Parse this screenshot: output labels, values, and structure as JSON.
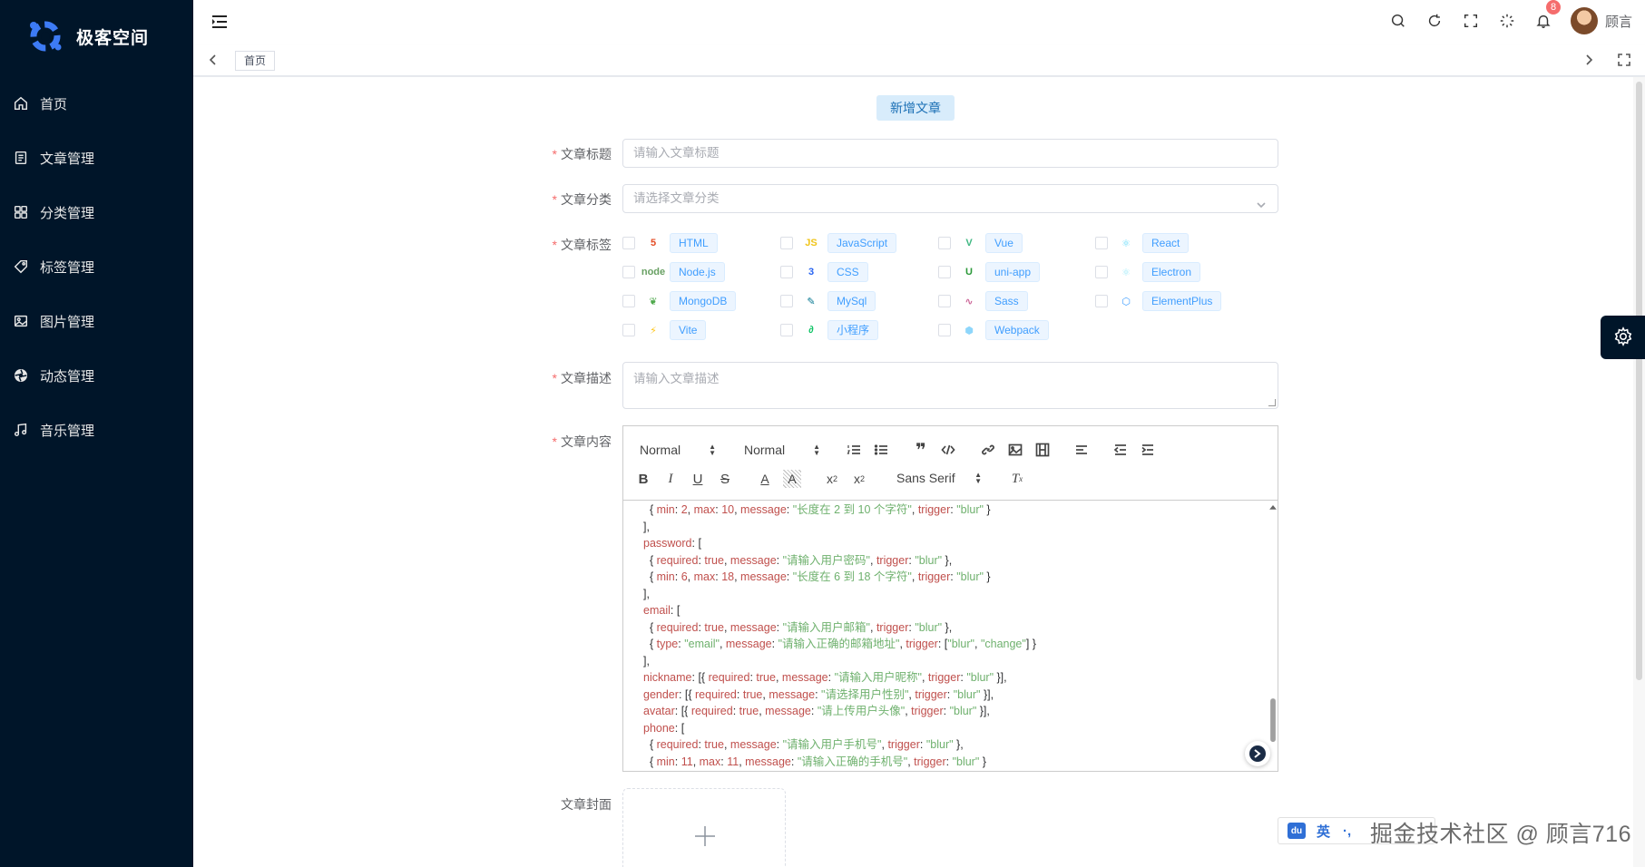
{
  "app": {
    "name": "极客空间"
  },
  "menu": [
    {
      "label": "首页",
      "icon": "home-icon"
    },
    {
      "label": "文章管理",
      "icon": "document-icon"
    },
    {
      "label": "分类管理",
      "icon": "grid-icon"
    },
    {
      "label": "标签管理",
      "icon": "tag-icon"
    },
    {
      "label": "图片管理",
      "icon": "image-icon"
    },
    {
      "label": "动态管理",
      "icon": "aperture-icon"
    },
    {
      "label": "音乐管理",
      "icon": "music-icon"
    }
  ],
  "header": {
    "notification_count": "8",
    "username": "顾言"
  },
  "tabs": {
    "home": "首页"
  },
  "page": {
    "title": "新增文章"
  },
  "form": {
    "title_label": "文章标题",
    "title_placeholder": "请输入文章标题",
    "category_label": "文章分类",
    "category_placeholder": "请选择文章分类",
    "tags_label": "文章标签",
    "desc_label": "文章描述",
    "desc_placeholder": "请输入文章描述",
    "content_label": "文章内容",
    "cover_label": "文章封面",
    "required_mark": "*"
  },
  "tags": [
    {
      "name": "HTML",
      "logo": "html5-icon",
      "color": "#e44d26",
      "glyph": "5"
    },
    {
      "name": "JavaScript",
      "logo": "js-icon",
      "color": "#f0c419",
      "glyph": "JS"
    },
    {
      "name": "Vue",
      "logo": "vue-icon",
      "color": "#41b883",
      "glyph": "V"
    },
    {
      "name": "React",
      "logo": "react-icon",
      "color": "#61dafb",
      "glyph": "⚛"
    },
    {
      "name": "Node.js",
      "logo": "nodejs-icon",
      "color": "#68a063",
      "glyph": "node"
    },
    {
      "name": "CSS",
      "logo": "css3-icon",
      "color": "#2965f1",
      "glyph": "3"
    },
    {
      "name": "uni-app",
      "logo": "uniapp-icon",
      "color": "#2b9939",
      "glyph": "U"
    },
    {
      "name": "Electron",
      "logo": "electron-icon",
      "color": "#9feaf9",
      "glyph": "⚛"
    },
    {
      "name": "MongoDB",
      "logo": "mongodb-icon",
      "color": "#4fa94d",
      "glyph": "❦"
    },
    {
      "name": "MySql",
      "logo": "mysql-icon",
      "color": "#00758f",
      "glyph": "✎"
    },
    {
      "name": "Sass",
      "logo": "sass-icon",
      "color": "#cd6799",
      "glyph": "∿"
    },
    {
      "name": "ElementPlus",
      "logo": "elementplus-icon",
      "color": "#409eff",
      "glyph": "⬡"
    },
    {
      "name": "Vite",
      "logo": "vite-icon",
      "color": "#ffc517",
      "glyph": "⚡"
    },
    {
      "name": "小程序",
      "logo": "miniprogram-icon",
      "color": "#07c160",
      "glyph": "∂"
    },
    {
      "name": "Webpack",
      "logo": "webpack-icon",
      "color": "#8ed6fb",
      "glyph": "⬢"
    }
  ],
  "editor": {
    "header_select": "Normal",
    "size_select": "Normal",
    "font_select": "Sans Serif",
    "code_lines": [
      [
        [
          "p",
          "  { "
        ],
        [
          "k",
          "min"
        ],
        [
          "p",
          ": "
        ],
        [
          "n",
          "2"
        ],
        [
          "p",
          ", "
        ],
        [
          "k",
          "max"
        ],
        [
          "p",
          ": "
        ],
        [
          "n",
          "10"
        ],
        [
          "p",
          ", "
        ],
        [
          "k",
          "message"
        ],
        [
          "p",
          ": "
        ],
        [
          "s",
          "\"长度在 2 到 10 个字符\""
        ],
        [
          "p",
          ", "
        ],
        [
          "k",
          "trigger"
        ],
        [
          "p",
          ": "
        ],
        [
          "s",
          "\"blur\""
        ],
        [
          "p",
          " }"
        ]
      ],
      [
        [
          "p",
          "],"
        ]
      ],
      [
        [
          "k",
          "password"
        ],
        [
          "p",
          ": ["
        ]
      ],
      [
        [
          "p",
          "  { "
        ],
        [
          "k",
          "required"
        ],
        [
          "p",
          ": "
        ],
        [
          "n",
          "true"
        ],
        [
          "p",
          ", "
        ],
        [
          "k",
          "message"
        ],
        [
          "p",
          ": "
        ],
        [
          "s",
          "\"请输入用户密码\""
        ],
        [
          "p",
          ", "
        ],
        [
          "k",
          "trigger"
        ],
        [
          "p",
          ": "
        ],
        [
          "s",
          "\"blur\""
        ],
        [
          "p",
          " },"
        ]
      ],
      [
        [
          "p",
          "  { "
        ],
        [
          "k",
          "min"
        ],
        [
          "p",
          ": "
        ],
        [
          "n",
          "6"
        ],
        [
          "p",
          ", "
        ],
        [
          "k",
          "max"
        ],
        [
          "p",
          ": "
        ],
        [
          "n",
          "18"
        ],
        [
          "p",
          ", "
        ],
        [
          "k",
          "message"
        ],
        [
          "p",
          ": "
        ],
        [
          "s",
          "\"长度在 6 到 18 个字符\""
        ],
        [
          "p",
          ", "
        ],
        [
          "k",
          "trigger"
        ],
        [
          "p",
          ": "
        ],
        [
          "s",
          "\"blur\""
        ],
        [
          "p",
          " }"
        ]
      ],
      [
        [
          "p",
          "],"
        ]
      ],
      [
        [
          "k",
          "email"
        ],
        [
          "p",
          ": ["
        ]
      ],
      [
        [
          "p",
          "  { "
        ],
        [
          "k",
          "required"
        ],
        [
          "p",
          ": "
        ],
        [
          "n",
          "true"
        ],
        [
          "p",
          ", "
        ],
        [
          "k",
          "message"
        ],
        [
          "p",
          ": "
        ],
        [
          "s",
          "\"请输入用户邮箱\""
        ],
        [
          "p",
          ", "
        ],
        [
          "k",
          "trigger"
        ],
        [
          "p",
          ": "
        ],
        [
          "s",
          "\"blur\""
        ],
        [
          "p",
          " },"
        ]
      ],
      [
        [
          "p",
          "  { "
        ],
        [
          "k",
          "type"
        ],
        [
          "p",
          ": "
        ],
        [
          "s",
          "\"email\""
        ],
        [
          "p",
          ", "
        ],
        [
          "k",
          "message"
        ],
        [
          "p",
          ": "
        ],
        [
          "s",
          "\"请输入正确的邮箱地址\""
        ],
        [
          "p",
          ", "
        ],
        [
          "k",
          "trigger"
        ],
        [
          "p",
          ": ["
        ],
        [
          "s",
          "\"blur\""
        ],
        [
          "p",
          ", "
        ],
        [
          "s",
          "\"change\""
        ],
        [
          "p",
          "] }"
        ]
      ],
      [
        [
          "p",
          "],"
        ]
      ],
      [
        [
          "k",
          "nickname"
        ],
        [
          "p",
          ": [{ "
        ],
        [
          "k",
          "required"
        ],
        [
          "p",
          ": "
        ],
        [
          "n",
          "true"
        ],
        [
          "p",
          ", "
        ],
        [
          "k",
          "message"
        ],
        [
          "p",
          ": "
        ],
        [
          "s",
          "\"请输入用户昵称\""
        ],
        [
          "p",
          ", "
        ],
        [
          "k",
          "trigger"
        ],
        [
          "p",
          ": "
        ],
        [
          "s",
          "\"blur\""
        ],
        [
          "p",
          " }],"
        ]
      ],
      [
        [
          "k",
          "gender"
        ],
        [
          "p",
          ": [{ "
        ],
        [
          "k",
          "required"
        ],
        [
          "p",
          ": "
        ],
        [
          "n",
          "true"
        ],
        [
          "p",
          ", "
        ],
        [
          "k",
          "message"
        ],
        [
          "p",
          ": "
        ],
        [
          "s",
          "\"请选择用户性别\""
        ],
        [
          "p",
          ", "
        ],
        [
          "k",
          "trigger"
        ],
        [
          "p",
          ": "
        ],
        [
          "s",
          "\"blur\""
        ],
        [
          "p",
          " }],"
        ]
      ],
      [
        [
          "k",
          "avatar"
        ],
        [
          "p",
          ": [{ "
        ],
        [
          "k",
          "required"
        ],
        [
          "p",
          ": "
        ],
        [
          "n",
          "true"
        ],
        [
          "p",
          ", "
        ],
        [
          "k",
          "message"
        ],
        [
          "p",
          ": "
        ],
        [
          "s",
          "\"请上传用户头像\""
        ],
        [
          "p",
          ", "
        ],
        [
          "k",
          "trigger"
        ],
        [
          "p",
          ": "
        ],
        [
          "s",
          "\"blur\""
        ],
        [
          "p",
          " }],"
        ]
      ],
      [
        [
          "k",
          "phone"
        ],
        [
          "p",
          ": ["
        ]
      ],
      [
        [
          "p",
          "  { "
        ],
        [
          "k",
          "required"
        ],
        [
          "p",
          ": "
        ],
        [
          "n",
          "true"
        ],
        [
          "p",
          ", "
        ],
        [
          "k",
          "message"
        ],
        [
          "p",
          ": "
        ],
        [
          "s",
          "\"请输入用户手机号\""
        ],
        [
          "p",
          ", "
        ],
        [
          "k",
          "trigger"
        ],
        [
          "p",
          ": "
        ],
        [
          "s",
          "\"blur\""
        ],
        [
          "p",
          " },"
        ]
      ],
      [
        [
          "p",
          "  { "
        ],
        [
          "k",
          "min"
        ],
        [
          "p",
          ": "
        ],
        [
          "n",
          "11"
        ],
        [
          "p",
          ", "
        ],
        [
          "k",
          "max"
        ],
        [
          "p",
          ": "
        ],
        [
          "n",
          "11"
        ],
        [
          "p",
          ", "
        ],
        [
          "k",
          "message"
        ],
        [
          "p",
          ": "
        ],
        [
          "s",
          "\"请输入正确的手机号\""
        ],
        [
          "p",
          ", "
        ],
        [
          "k",
          "trigger"
        ],
        [
          "p",
          ": "
        ],
        [
          "s",
          "\"blur\""
        ],
        [
          "p",
          " }"
        ]
      ]
    ]
  },
  "ime": {
    "brand": "du",
    "lang": "英",
    "extra": "·,"
  },
  "watermark": "掘金技术社区 @ 顾言716"
}
